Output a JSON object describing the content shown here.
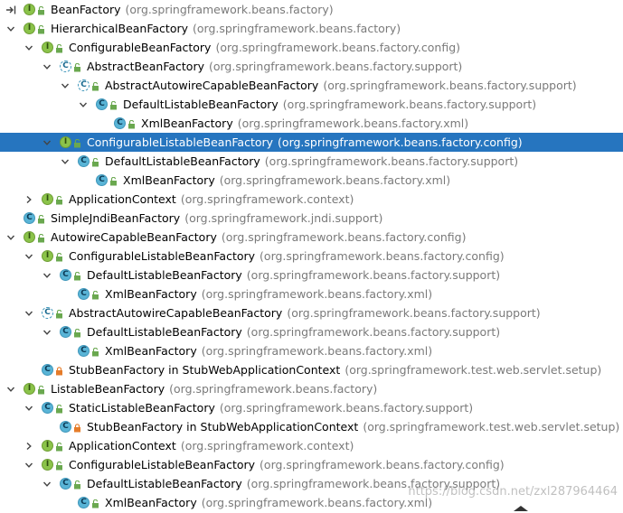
{
  "rows": [
    {
      "indent": 0,
      "arrow": "none",
      "top_special": true,
      "kind": "iface",
      "letter": "I",
      "vis": "public",
      "name": "BeanFactory",
      "pkg": "(org.springframework.beans.factory)",
      "selected": false
    },
    {
      "indent": 0,
      "arrow": "down",
      "kind": "iface",
      "letter": "I",
      "vis": "public",
      "name": "HierarchicalBeanFactory",
      "pkg": "(org.springframework.beans.factory)",
      "selected": false
    },
    {
      "indent": 1,
      "arrow": "down",
      "kind": "iface",
      "letter": "I",
      "vis": "public",
      "name": "ConfigurableBeanFactory",
      "pkg": "(org.springframework.beans.factory.config)",
      "selected": false
    },
    {
      "indent": 2,
      "arrow": "down",
      "kind": "abs",
      "letter": "C",
      "vis": "public",
      "name": "AbstractBeanFactory",
      "pkg": "(org.springframework.beans.factory.support)",
      "selected": false
    },
    {
      "indent": 3,
      "arrow": "down",
      "kind": "abs",
      "letter": "C",
      "vis": "public",
      "name": "AbstractAutowireCapableBeanFactory",
      "pkg": "(org.springframework.beans.factory.support)",
      "selected": false
    },
    {
      "indent": 4,
      "arrow": "down",
      "kind": "cls",
      "letter": "C",
      "vis": "public",
      "name": "DefaultListableBeanFactory",
      "pkg": "(org.springframework.beans.factory.support)",
      "selected": false
    },
    {
      "indent": 5,
      "arrow": "none",
      "kind": "cls",
      "letter": "C",
      "vis": "public",
      "name": "XmlBeanFactory",
      "pkg": "(org.springframework.beans.factory.xml)",
      "selected": false
    },
    {
      "indent": 2,
      "arrow": "down",
      "kind": "iface",
      "letter": "I",
      "vis": "public",
      "name": "ConfigurableListableBeanFactory",
      "pkg": "(org.springframework.beans.factory.config)",
      "selected": true
    },
    {
      "indent": 3,
      "arrow": "down",
      "kind": "cls",
      "letter": "C",
      "vis": "public",
      "name": "DefaultListableBeanFactory",
      "pkg": "(org.springframework.beans.factory.support)",
      "selected": false
    },
    {
      "indent": 4,
      "arrow": "none",
      "kind": "cls",
      "letter": "C",
      "vis": "public",
      "name": "XmlBeanFactory",
      "pkg": "(org.springframework.beans.factory.xml)",
      "selected": false
    },
    {
      "indent": 1,
      "arrow": "right",
      "kind": "iface",
      "letter": "I",
      "vis": "public",
      "name": "ApplicationContext",
      "pkg": "(org.springframework.context)",
      "selected": false
    },
    {
      "indent": 0,
      "arrow": "none",
      "kind": "cls",
      "letter": "C",
      "vis": "public",
      "name": "SimpleJndiBeanFactory",
      "pkg": "(org.springframework.jndi.support)",
      "selected": false
    },
    {
      "indent": 0,
      "arrow": "down",
      "kind": "iface",
      "letter": "I",
      "vis": "public",
      "name": "AutowireCapableBeanFactory",
      "pkg": "(org.springframework.beans.factory.config)",
      "selected": false
    },
    {
      "indent": 1,
      "arrow": "down",
      "kind": "iface",
      "letter": "I",
      "vis": "public",
      "name": "ConfigurableListableBeanFactory",
      "pkg": "(org.springframework.beans.factory.config)",
      "selected": false
    },
    {
      "indent": 2,
      "arrow": "down",
      "kind": "cls",
      "letter": "C",
      "vis": "public",
      "name": "DefaultListableBeanFactory",
      "pkg": "(org.springframework.beans.factory.support)",
      "selected": false
    },
    {
      "indent": 3,
      "arrow": "none",
      "kind": "cls",
      "letter": "C",
      "vis": "public",
      "name": "XmlBeanFactory",
      "pkg": "(org.springframework.beans.factory.xml)",
      "selected": false
    },
    {
      "indent": 1,
      "arrow": "down",
      "kind": "abs",
      "letter": "C",
      "vis": "public",
      "name": "AbstractAutowireCapableBeanFactory",
      "pkg": "(org.springframework.beans.factory.support)",
      "selected": false
    },
    {
      "indent": 2,
      "arrow": "down",
      "kind": "cls",
      "letter": "C",
      "vis": "public",
      "name": "DefaultListableBeanFactory",
      "pkg": "(org.springframework.beans.factory.support)",
      "selected": false
    },
    {
      "indent": 3,
      "arrow": "none",
      "kind": "cls",
      "letter": "C",
      "vis": "public",
      "name": "XmlBeanFactory",
      "pkg": "(org.springframework.beans.factory.xml)",
      "selected": false
    },
    {
      "indent": 1,
      "arrow": "none",
      "kind": "cls",
      "letter": "C",
      "vis": "private",
      "name": "StubBeanFactory in StubWebApplicationContext",
      "pkg": "(org.springframework.test.web.servlet.setup)",
      "selected": false
    },
    {
      "indent": 0,
      "arrow": "down",
      "kind": "iface",
      "letter": "I",
      "vis": "public",
      "name": "ListableBeanFactory",
      "pkg": "(org.springframework.beans.factory)",
      "selected": false
    },
    {
      "indent": 1,
      "arrow": "down",
      "kind": "cls",
      "letter": "C",
      "vis": "public",
      "name": "StaticListableBeanFactory",
      "pkg": "(org.springframework.beans.factory.support)",
      "selected": false
    },
    {
      "indent": 2,
      "arrow": "none",
      "kind": "cls",
      "letter": "C",
      "vis": "private",
      "name": "StubBeanFactory in StubWebApplicationContext",
      "pkg": "(org.springframework.test.web.servlet.setup)",
      "selected": false
    },
    {
      "indent": 1,
      "arrow": "right",
      "kind": "iface",
      "letter": "I",
      "vis": "public",
      "name": "ApplicationContext",
      "pkg": "(org.springframework.context)",
      "selected": false
    },
    {
      "indent": 1,
      "arrow": "down",
      "kind": "iface",
      "letter": "I",
      "vis": "public",
      "name": "ConfigurableListableBeanFactory",
      "pkg": "(org.springframework.beans.factory.config)",
      "selected": false
    },
    {
      "indent": 2,
      "arrow": "down",
      "kind": "cls",
      "letter": "C",
      "vis": "public",
      "name": "DefaultListableBeanFactory",
      "pkg": "(org.springframework.beans.factory.support)",
      "selected": false
    },
    {
      "indent": 3,
      "arrow": "none",
      "kind": "cls",
      "letter": "C",
      "vis": "public",
      "name": "XmlBeanFactory",
      "pkg": "(org.springframework.beans.factory.xml)",
      "selected": false
    }
  ],
  "watermark": "https://blog.csdn.net/zxl287964464",
  "colors": {
    "selection": "#2675bf",
    "interface_icon": "#8bc34a",
    "class_icon": "#59b4d6",
    "package_text": "#7a7a7a",
    "unlocked": "#6aa84f",
    "locked": "#e57c2a"
  },
  "icons": {
    "expand_arrow": "chevron-down-icon",
    "collapse_arrow": "chevron-right-icon",
    "interface": "interface-icon",
    "class": "class-icon",
    "abstract_class": "abstract-class-icon",
    "public": "unlock-icon",
    "private": "lock-icon"
  }
}
